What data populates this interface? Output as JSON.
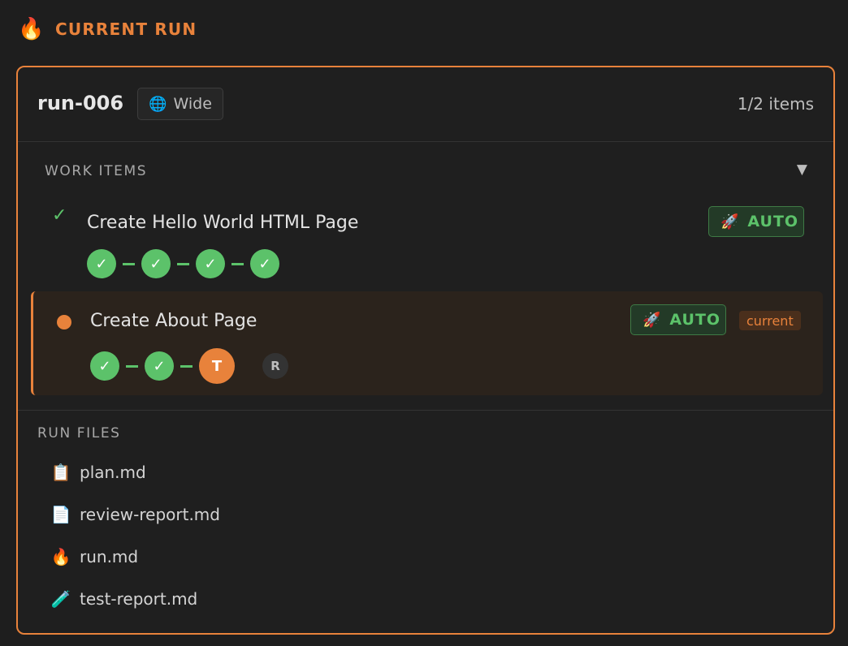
{
  "header": {
    "icon": "fire-icon",
    "title": "CURRENT RUN"
  },
  "run": {
    "id": "run-006",
    "scope": {
      "icon": "globe-icon",
      "label": "Wide"
    },
    "items_count": "1/2 items"
  },
  "work_items": {
    "label": "WORK ITEMS",
    "collapse_icon": "▼",
    "items": [
      {
        "title": "Create Hello World HTML Page",
        "status": "complete",
        "status_icon": "✓",
        "mode": {
          "icon": "rocket-icon",
          "label": "AUTO"
        },
        "stages": [
          "✓",
          "✓",
          "✓",
          "✓"
        ]
      },
      {
        "title": "Create About Page",
        "status": "in-progress",
        "mode": {
          "icon": "rocket-icon",
          "label": "AUTO"
        },
        "tag": "current",
        "stages": [
          "✓",
          "✓",
          "T",
          "R"
        ]
      }
    ]
  },
  "run_files": {
    "label": "RUN FILES",
    "files": [
      {
        "icon": "clipboard-icon",
        "name": "plan.md"
      },
      {
        "icon": "document-icon",
        "name": "review-report.md"
      },
      {
        "icon": "fire-icon",
        "name": "run.md"
      },
      {
        "icon": "test-tube-icon",
        "name": "test-report.md"
      }
    ]
  },
  "colors": {
    "accent": "#e8823b",
    "success": "#5cc26a",
    "background": "#1e1e1e"
  }
}
